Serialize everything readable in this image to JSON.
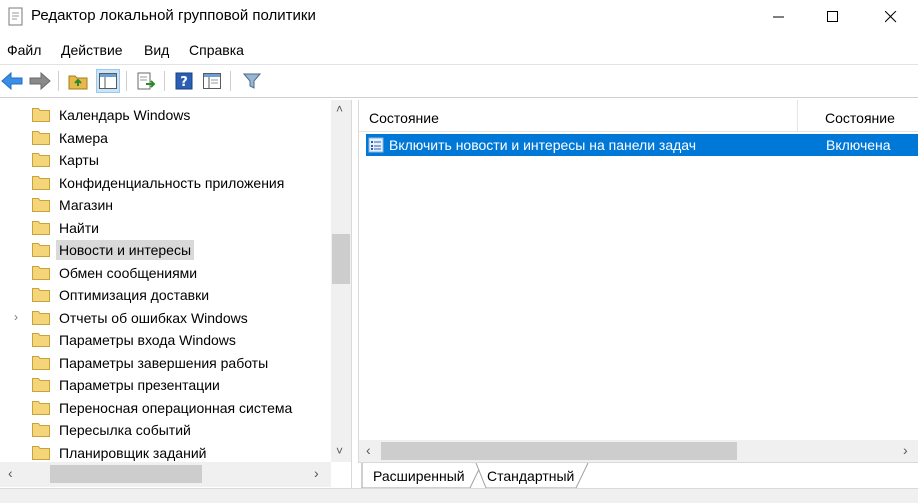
{
  "window": {
    "title": "Редактор локальной групповой политики",
    "controls": {
      "minimize": "—",
      "maximize": "☐",
      "close": "✕"
    }
  },
  "menu": [
    "Файл",
    "Действие",
    "Вид",
    "Справка"
  ],
  "toolbar": {
    "icons": [
      "back-arrow-icon",
      "forward-arrow-icon",
      "up-folder-icon",
      "show-hide-tree-icon",
      "export-list-icon",
      "help-icon",
      "properties-icon",
      "filter-icon"
    ]
  },
  "tree": {
    "items": [
      {
        "label": "Календарь Windows"
      },
      {
        "label": "Камера"
      },
      {
        "label": "Карты"
      },
      {
        "label": "Конфиденциальность приложения"
      },
      {
        "label": "Магазин"
      },
      {
        "label": "Найти"
      },
      {
        "label": "Новости и интересы",
        "selected": true
      },
      {
        "label": "Обмен сообщениями"
      },
      {
        "label": "Оптимизация доставки"
      },
      {
        "label": "Отчеты об ошибках Windows",
        "expandable": true
      },
      {
        "label": "Параметры входа Windows"
      },
      {
        "label": "Параметры завершения работы"
      },
      {
        "label": "Параметры презентации"
      },
      {
        "label": "Переносная операционная система"
      },
      {
        "label": "Пересылка событий"
      },
      {
        "label": "Планировщик заданий"
      }
    ],
    "expander_glyph": "›",
    "scroll_up": "˄",
    "scroll_down": "˅",
    "scroll_left": "‹",
    "scroll_right": "›"
  },
  "list": {
    "columns": [
      "Состояние",
      "Состояние"
    ],
    "rows": [
      {
        "name": "Включить новости и интересы на панели задач",
        "state": "Включена"
      }
    ],
    "scroll_left": "‹",
    "scroll_right": "›"
  },
  "tabs": [
    "Расширенный",
    "Стандартный"
  ],
  "colors": {
    "selection": "#0078d7",
    "tree_selection": "#d9d9d9",
    "folder": "#f5d57a"
  }
}
